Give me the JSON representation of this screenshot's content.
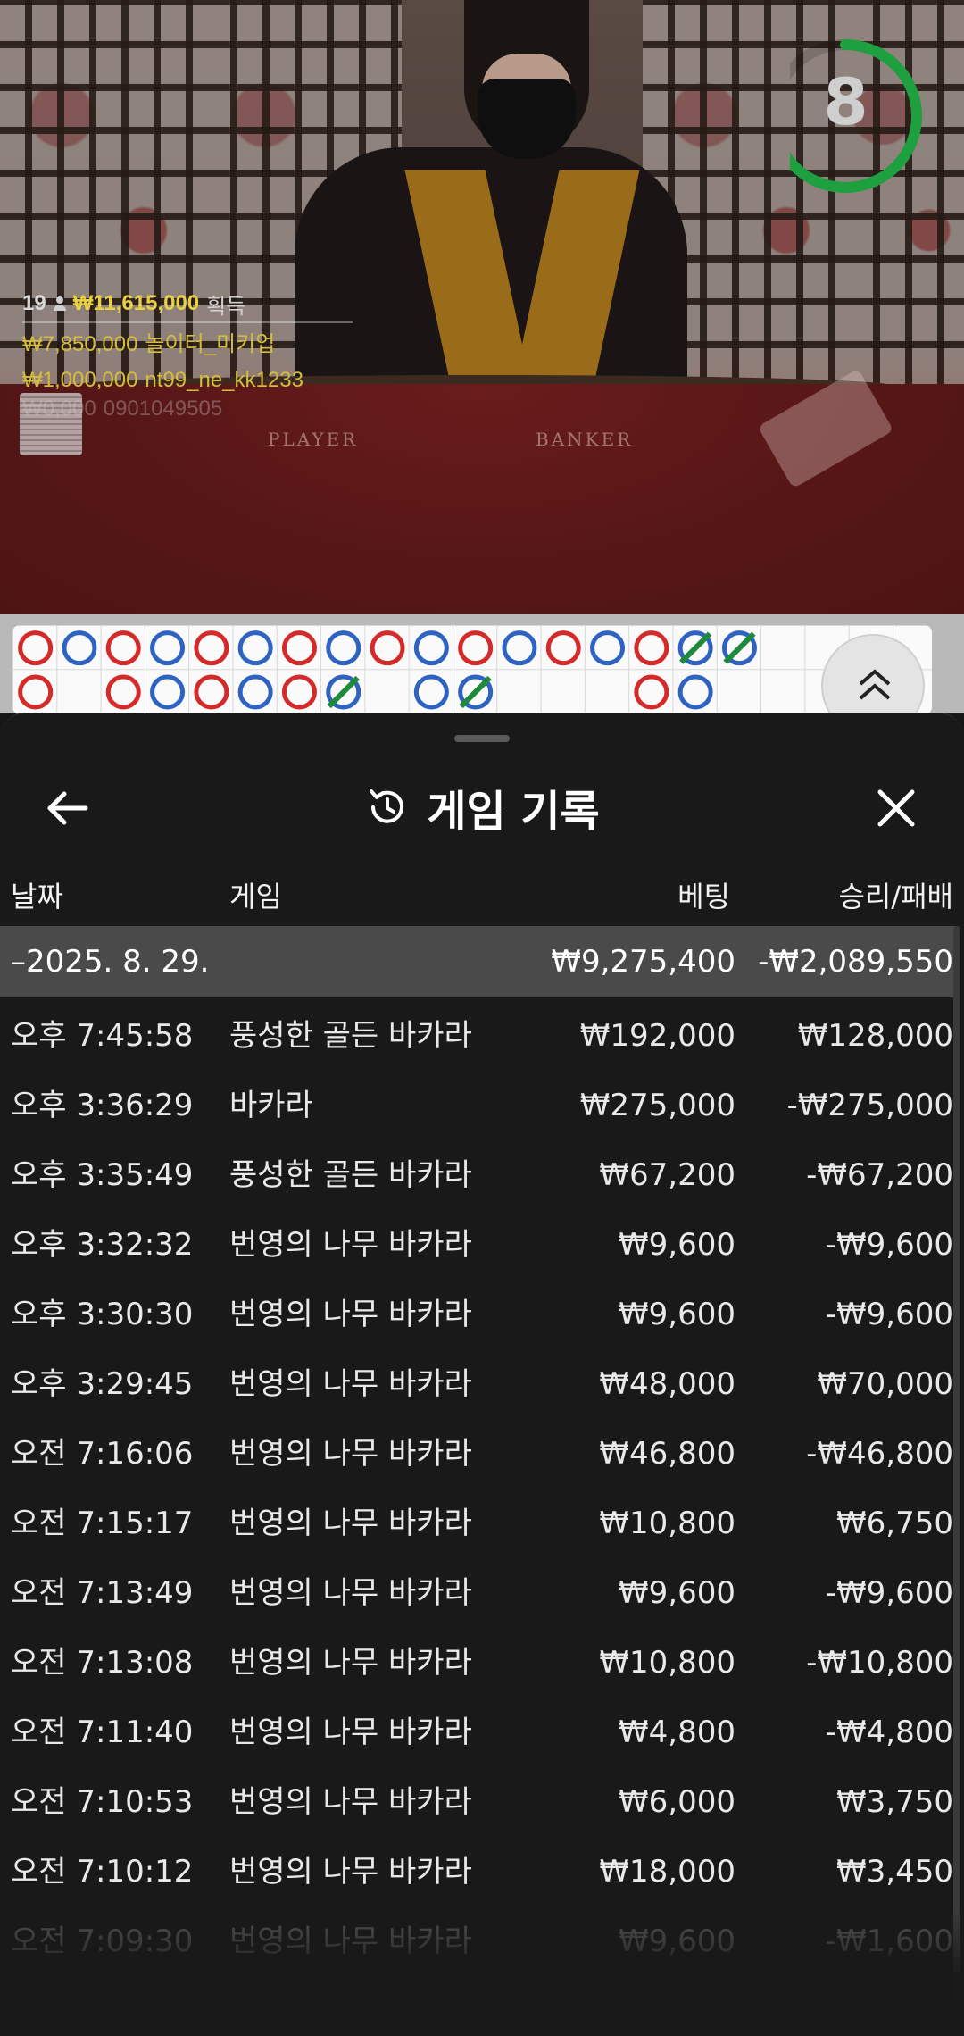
{
  "video": {
    "timer": {
      "value": "8",
      "fraction_remaining": 0.75,
      "color": "#1fa040"
    },
    "win_overlay": {
      "player_count": "19",
      "total_amount": "₩11,615,000",
      "total_label": "획득",
      "winners": [
        {
          "amount": "₩7,850,000",
          "name": "놀이터_미키업"
        },
        {
          "amount": "₩1,000,000",
          "name": "nt99_ne_kk1233"
        },
        {
          "amount": "₩0,000",
          "name": "0901049505"
        }
      ]
    },
    "felt": {
      "player": "PLAYER",
      "banker": "BANKER"
    }
  },
  "bead_road": {
    "colors": {
      "player": "#2f63c2",
      "banker": "#d42a2a",
      "tie": "#1e8a3a"
    },
    "columns": [
      [
        "B",
        "B"
      ],
      [
        "P"
      ],
      [
        "B",
        "B"
      ],
      [
        "P",
        "P"
      ],
      [
        "B",
        "B"
      ],
      [
        "P",
        "P"
      ],
      [
        "B",
        "B"
      ],
      [
        "P",
        "T"
      ],
      [
        "B"
      ],
      [
        "P",
        "P"
      ],
      [
        "B",
        "T"
      ],
      [
        "P"
      ],
      [
        "B"
      ],
      [
        "P"
      ],
      [
        "B",
        "B"
      ],
      [
        "T",
        "P"
      ],
      [
        "T"
      ]
    ]
  },
  "sheet": {
    "title": "게임 기록",
    "columns": {
      "date": "날짜",
      "game": "게임",
      "bet": "베팅",
      "win_loss": "승리/패배"
    },
    "date_group": {
      "date": "–2025. 8. 29.",
      "bet_total": "₩9,275,400",
      "win_total": "-₩2,089,550"
    },
    "rows": [
      {
        "time": "오후 7:45:58",
        "game": "풍성한 골든 바카라",
        "bet": "₩192,000",
        "result": "₩128,000"
      },
      {
        "time": "오후 3:36:29",
        "game": "바카라",
        "bet": "₩275,000",
        "result": "-₩275,000"
      },
      {
        "time": "오후 3:35:49",
        "game": "풍성한 골든 바카라",
        "bet": "₩67,200",
        "result": "-₩67,200"
      },
      {
        "time": "오후 3:32:32",
        "game": "번영의 나무 바카라",
        "bet": "₩9,600",
        "result": "-₩9,600"
      },
      {
        "time": "오후 3:30:30",
        "game": "번영의 나무 바카라",
        "bet": "₩9,600",
        "result": "-₩9,600"
      },
      {
        "time": "오후 3:29:45",
        "game": "번영의 나무 바카라",
        "bet": "₩48,000",
        "result": "₩70,000"
      },
      {
        "time": "오전 7:16:06",
        "game": "번영의 나무 바카라",
        "bet": "₩46,800",
        "result": "-₩46,800"
      },
      {
        "time": "오전 7:15:17",
        "game": "번영의 나무 바카라",
        "bet": "₩10,800",
        "result": "₩6,750"
      },
      {
        "time": "오전 7:13:49",
        "game": "번영의 나무 바카라",
        "bet": "₩9,600",
        "result": "-₩9,600"
      },
      {
        "time": "오전 7:13:08",
        "game": "번영의 나무 바카라",
        "bet": "₩10,800",
        "result": "-₩10,800"
      },
      {
        "time": "오전 7:11:40",
        "game": "번영의 나무 바카라",
        "bet": "₩4,800",
        "result": "-₩4,800"
      },
      {
        "time": "오전 7:10:53",
        "game": "번영의 나무 바카라",
        "bet": "₩6,000",
        "result": "₩3,750"
      },
      {
        "time": "오전 7:10:12",
        "game": "번영의 나무 바카라",
        "bet": "₩18,000",
        "result": "₩3,450"
      },
      {
        "time": "오전 7:09:30",
        "game": "번영의 나무 바카라",
        "bet": "₩9,600",
        "result": "-₩1,600"
      }
    ]
  }
}
